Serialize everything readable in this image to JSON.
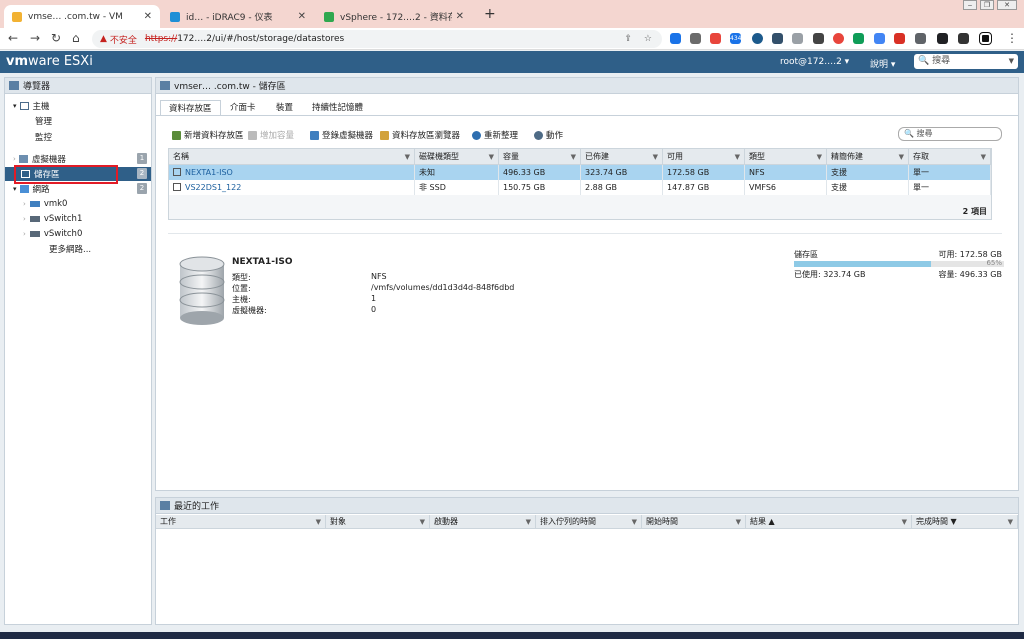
{
  "browser": {
    "tabs": [
      {
        "title": "vmse… .com.tw - VM",
        "active": true,
        "color": "#f2b233"
      },
      {
        "title": "id… - iDRAC9 - 仪表",
        "active": false,
        "color": "#1f8fd6"
      },
      {
        "title": "vSphere - 172.…2 - 資料存放…",
        "active": false,
        "color": "#2fa84f"
      }
    ],
    "new_tab": "+",
    "insecure_label": "不安全",
    "url_scheme": "https://",
    "url_rest": "172.…2/ui/#/host/storage/datastores",
    "ext_badge": "434"
  },
  "esxi": {
    "logo_vm": "vm",
    "logo_ware": "ware",
    "logo_product": "ESXi",
    "user": "root@172.…2 ▾",
    "help": "說明 ▾",
    "search_placeholder": "搜尋"
  },
  "navigator": {
    "title": "導覽器",
    "host": "主機",
    "manage": "管理",
    "monitor": "監控",
    "vms": "虛擬機器",
    "vms_count": "1",
    "storage": "儲存區",
    "storage_count": "2",
    "network": "網路",
    "network_count": "2",
    "net_items": [
      "vmk0",
      "vSwitch1",
      "vSwitch0"
    ],
    "more_networks": "更多網路..."
  },
  "main": {
    "title": "vmser… .com.tw - 儲存區",
    "tabs": [
      "資料存放區",
      "介面卡",
      "裝置",
      "持續性記憶體"
    ],
    "toolbar": {
      "new_ds": "新增資料存放區",
      "increase": "增加容量",
      "register_vm": "登錄虛擬機器",
      "ds_browser": "資料存放區瀏覽器",
      "refresh": "重新整理",
      "actions": "動作"
    },
    "search_placeholder": "搜尋",
    "columns": [
      "名稱",
      "磁碟機類型",
      "容量",
      "已佈建",
      "可用",
      "類型",
      "精簡佈建",
      "存取"
    ],
    "rows": [
      [
        "NEXTA1-ISO",
        "未知",
        "496.33 GB",
        "323.74 GB",
        "172.58 GB",
        "NFS",
        "支援",
        "單一"
      ],
      [
        "VS22DS1_122",
        "非 SSD",
        "150.75 GB",
        "2.88 GB",
        "147.87 GB",
        "VMFS6",
        "支援",
        "單一"
      ]
    ],
    "footer": "2 項目",
    "detail": {
      "name": "NEXTA1-ISO",
      "labels": [
        "類型:",
        "位置:",
        "主機:",
        "虛擬機器:"
      ],
      "values": [
        "NFS",
        "/vmfs/volumes/dd1d3d4d-848f6dbd",
        "1",
        "0"
      ],
      "storage_label": "儲存區",
      "free": "可用: 172.58 GB",
      "percent": "65%",
      "used": "已使用: 323.74 GB",
      "capacity": "容量: 496.33 GB",
      "used_fraction": 0.65
    }
  },
  "tasks": {
    "title": "最近的工作",
    "columns": [
      "工作",
      "對象",
      "啟動器",
      "排入佇列的時間",
      "開始時間",
      "結果 ▲",
      "完成時間 ▼"
    ]
  }
}
